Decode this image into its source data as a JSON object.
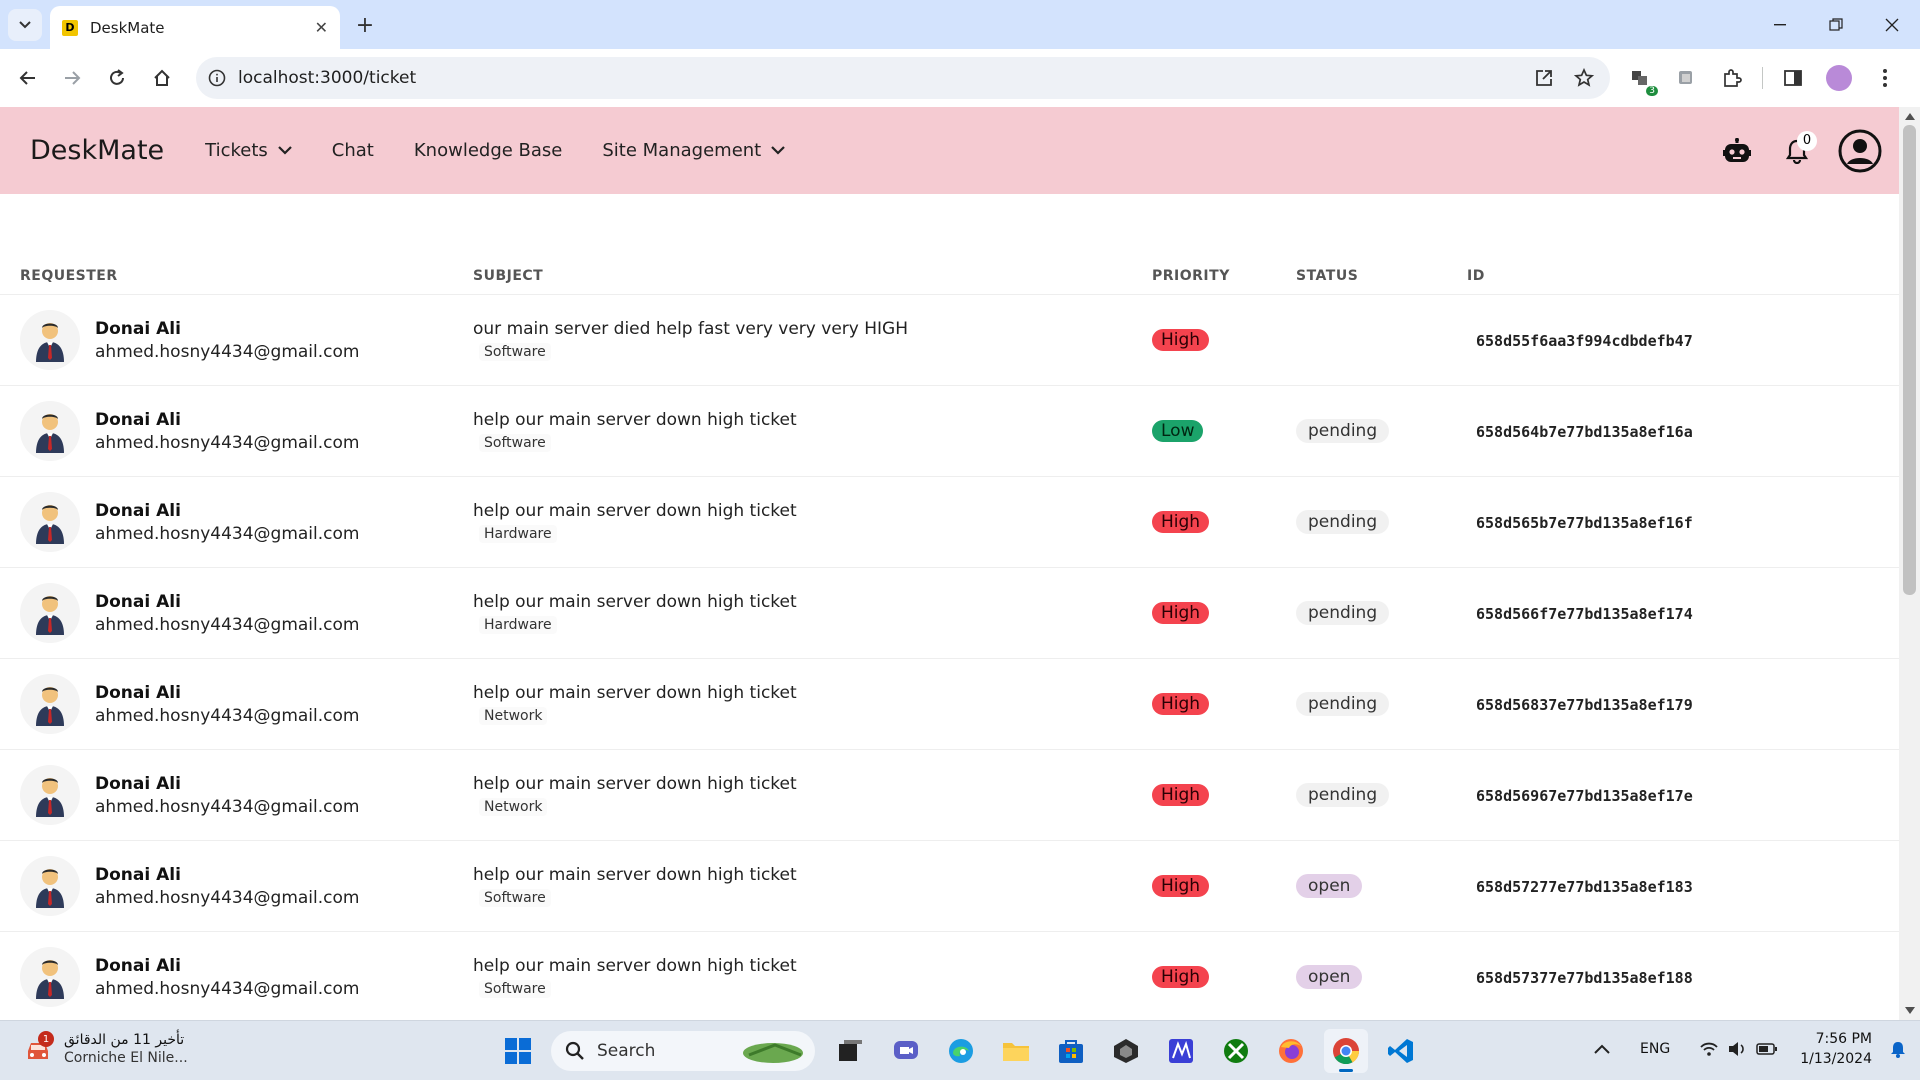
{
  "browser": {
    "tab_title": "DeskMate",
    "favicon_letter": "D",
    "url": "localhost:3000/ticket",
    "extension_badge": "3"
  },
  "app": {
    "brand": "DeskMate",
    "nav": {
      "tickets": "Tickets",
      "chat": "Chat",
      "knowledge_base": "Knowledge Base",
      "site_management": "Site Management"
    },
    "notification_count": "0"
  },
  "table": {
    "headers": {
      "requester": "REQUESTER",
      "subject": "SUBJECT",
      "priority": "PRIORITY",
      "status": "STATUS",
      "id": "ID"
    },
    "rows": [
      {
        "name": "Donai Ali",
        "email": "ahmed.hosny4434@gmail.com",
        "subject": "our main server died help fast very very very HIGH",
        "category": "Software",
        "priority": "High",
        "status": "",
        "id": "658d55f6aa3f994cdbdefb47"
      },
      {
        "name": "Donai Ali",
        "email": "ahmed.hosny4434@gmail.com",
        "subject": "help our main server down high ticket",
        "category": "Software",
        "priority": "Low",
        "status": "pending",
        "id": "658d564b7e77bd135a8ef16a"
      },
      {
        "name": "Donai Ali",
        "email": "ahmed.hosny4434@gmail.com",
        "subject": "help our main server down high ticket",
        "category": "Hardware",
        "priority": "High",
        "status": "pending",
        "id": "658d565b7e77bd135a8ef16f"
      },
      {
        "name": "Donai Ali",
        "email": "ahmed.hosny4434@gmail.com",
        "subject": "help our main server down high ticket",
        "category": "Hardware",
        "priority": "High",
        "status": "pending",
        "id": "658d566f7e77bd135a8ef174"
      },
      {
        "name": "Donai Ali",
        "email": "ahmed.hosny4434@gmail.com",
        "subject": "help our main server down high ticket",
        "category": "Network",
        "priority": "High",
        "status": "pending",
        "id": "658d56837e77bd135a8ef179"
      },
      {
        "name": "Donai Ali",
        "email": "ahmed.hosny4434@gmail.com",
        "subject": "help our main server down high ticket",
        "category": "Network",
        "priority": "High",
        "status": "pending",
        "id": "658d56967e77bd135a8ef17e"
      },
      {
        "name": "Donai Ali",
        "email": "ahmed.hosny4434@gmail.com",
        "subject": "help our main server down high ticket",
        "category": "Software",
        "priority": "High",
        "status": "open",
        "id": "658d57277e77bd135a8ef183"
      },
      {
        "name": "Donai Ali",
        "email": "ahmed.hosny4434@gmail.com",
        "subject": "help our main server down high ticket",
        "category": "Software",
        "priority": "High",
        "status": "open",
        "id": "658d57377e77bd135a8ef188"
      }
    ]
  },
  "taskbar": {
    "weather_line1": "تأخير 11 من الدقائق",
    "weather_line2": "Corniche El Nile...",
    "weather_badge": "1",
    "search_placeholder": "Search",
    "language": "ENG",
    "time": "7:56 PM",
    "date": "1/13/2024"
  },
  "colors": {
    "navbar_bg": "#f5cbd2",
    "priority_high": "#f4434e",
    "priority_low": "#1ba36a",
    "status_open": "#e3d0e8"
  }
}
